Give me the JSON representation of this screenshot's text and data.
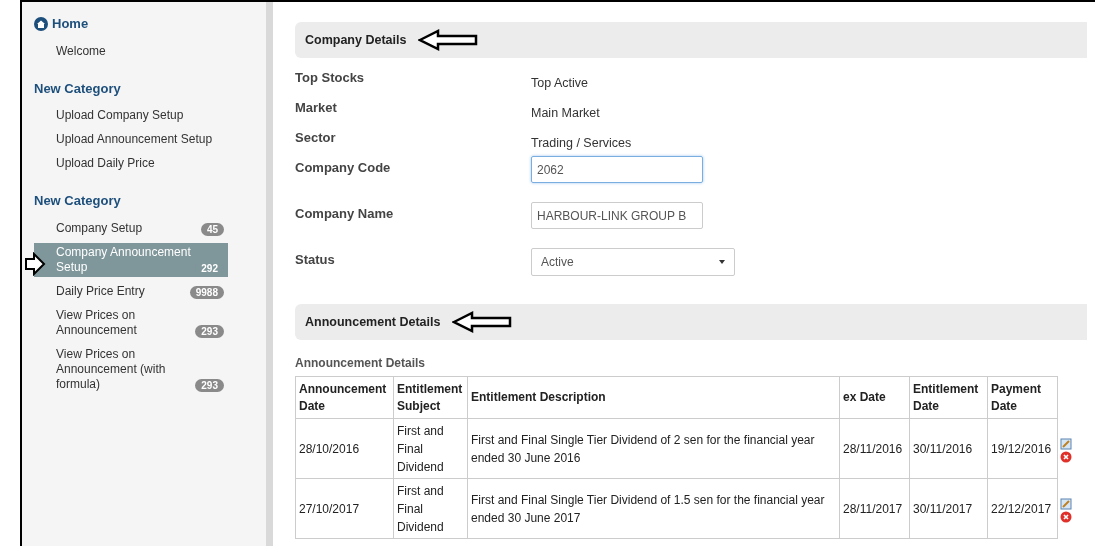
{
  "sidebar": {
    "sections": [
      {
        "title": "Home",
        "kind": "home",
        "items": [
          {
            "label": "Welcome",
            "selected": false
          }
        ]
      },
      {
        "title": "New Category",
        "kind": "plain",
        "items": [
          {
            "label": "Upload Company Setup",
            "selected": false
          },
          {
            "label": "Upload Announcement Setup",
            "selected": false
          },
          {
            "label": "Upload Daily Price",
            "selected": false
          }
        ]
      },
      {
        "title": "New Category",
        "kind": "plain",
        "items": [
          {
            "label": "Company Setup",
            "badge": "45",
            "selected": false
          },
          {
            "label": "Company Announcement Setup",
            "badge": "292",
            "selected": true
          },
          {
            "label": "Daily Price Entry",
            "badge": "9988",
            "selected": false
          },
          {
            "label": "View Prices on Announcement",
            "badge": "293",
            "selected": false
          },
          {
            "label": "View Prices on Announcement (with formula)",
            "badge": "293",
            "selected": false
          }
        ]
      }
    ]
  },
  "company_details": {
    "heading": "Company Details",
    "fields": [
      {
        "kind": "text",
        "label": "Top Stocks",
        "value": "Top Active"
      },
      {
        "kind": "text",
        "label": "Market",
        "value": "Main Market"
      },
      {
        "kind": "text",
        "label": "Sector",
        "value": "Trading / Services"
      },
      {
        "kind": "input",
        "label": "Company Code",
        "value": "2062",
        "focused": true
      },
      {
        "kind": "input",
        "label": "Company Name",
        "value": "HARBOUR-LINK GROUP B",
        "focused": false
      },
      {
        "kind": "select",
        "label": "Status",
        "value": "Active"
      }
    ]
  },
  "announcement_details": {
    "heading": "Announcement Details",
    "caption": "Announcement Details",
    "table": {
      "columns": [
        "Announcement Date",
        "Entitlement Subject",
        "Entitlement Description",
        "ex Date",
        "Entitlement Date",
        "Payment Date"
      ],
      "rows": [
        [
          "28/10/2016",
          "First and Final Dividend",
          "First and Final Single Tier Dividend of 2 sen for the financial year ended 30 June 2016",
          "28/11/2016",
          "30/11/2016",
          "19/12/2016"
        ],
        [
          "27/10/2017",
          "First and Final Dividend",
          "First and Final Single Tier Dividend of 1.5 sen for the financial year ended 30 June 2017",
          "28/11/2017",
          "30/11/2017",
          "22/12/2017"
        ]
      ]
    }
  }
}
